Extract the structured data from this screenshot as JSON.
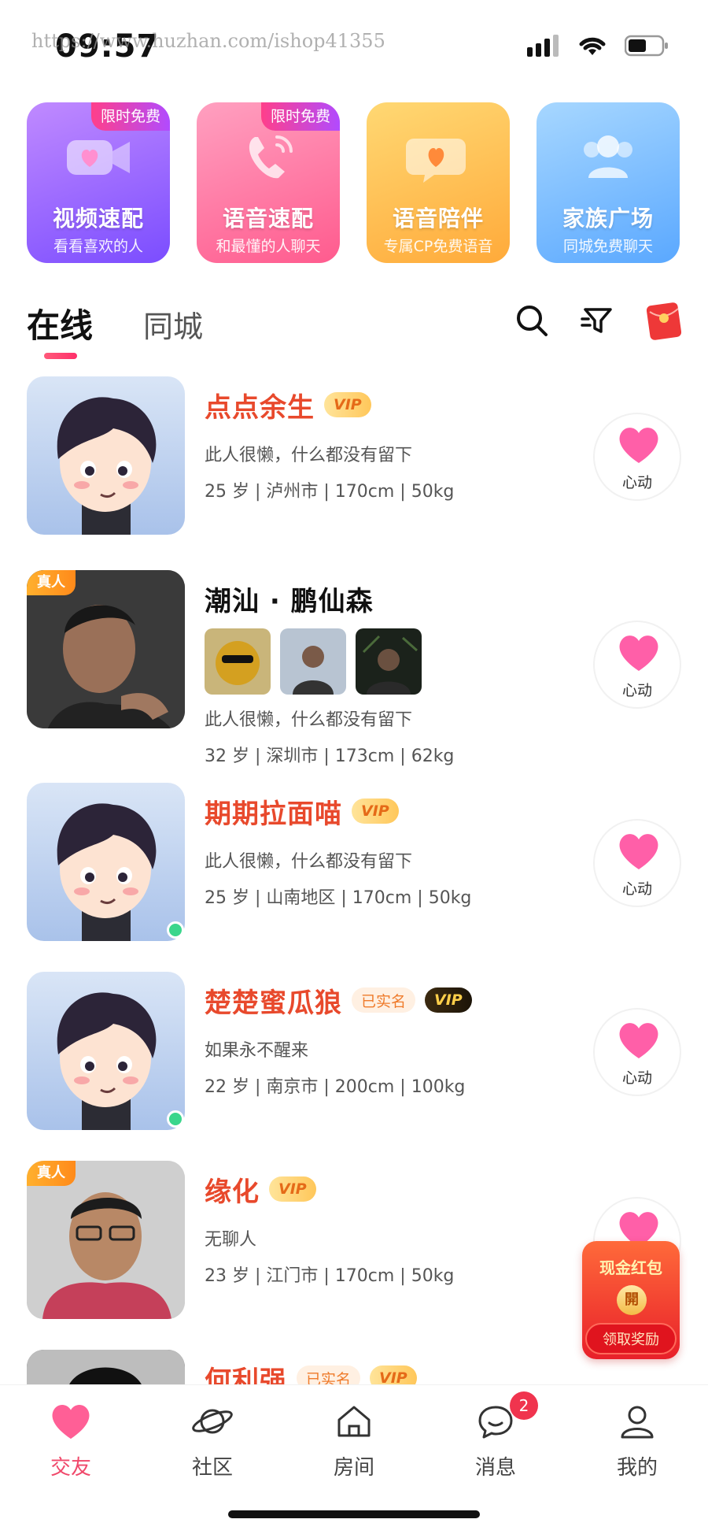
{
  "status_bar": {
    "time": "09:57",
    "watermark": "https://www.huzhan.com/ishop41355"
  },
  "features": [
    {
      "title": "视频速配",
      "subtitle": "看看喜欢的人",
      "badge": "限时免费",
      "gradient_from": "#b57bff",
      "gradient_to": "#7a4dff",
      "icon": "video-camera-icon"
    },
    {
      "title": "语音速配",
      "subtitle": "和最懂的人聊天",
      "badge": "限时免费",
      "gradient_from": "#ff93b6",
      "gradient_to": "#ff5f8f",
      "icon": "phone-icon"
    },
    {
      "title": "语音陪伴",
      "subtitle": "专属CP免费语音",
      "badge": "",
      "gradient_from": "#ffd466",
      "gradient_to": "#ffab3a",
      "icon": "chat-heart-icon"
    },
    {
      "title": "家族广场",
      "subtitle": "同城免费聊天",
      "badge": "",
      "gradient_from": "#9fd3ff",
      "gradient_to": "#5aa8ff",
      "icon": "group-icon"
    }
  ],
  "tabs": {
    "online": "在线",
    "local": "同城"
  },
  "users": [
    {
      "name": "点点余生",
      "vip": "VIP",
      "verified": "",
      "bio": "此人很懒，什么都没有留下",
      "meta": "25 岁 | 泸州市 | 170cm | 50kg",
      "avatar": "cartoon",
      "real_badge": "",
      "online": false,
      "like_label": "心动"
    },
    {
      "name": "潮汕 · 鹏仙森",
      "vip": "",
      "verified": "",
      "bio": "此人很懒，什么都没有留下",
      "meta": "32 岁 | 深圳市 | 173cm | 62kg",
      "avatar": "photo",
      "real_badge": "真人",
      "online": false,
      "like_label": "心动",
      "thumbs": 3
    },
    {
      "name": "期期拉面喵",
      "vip": "VIP",
      "verified": "",
      "bio": "此人很懒，什么都没有留下",
      "meta": "25 岁 | 山南地区 | 170cm | 50kg",
      "avatar": "cartoon",
      "real_badge": "",
      "online": true,
      "like_label": "心动"
    },
    {
      "name": "楚楚蜜瓜狼",
      "vip": "VIP",
      "vip_style": "dark",
      "verified": "已实名",
      "bio": "如果永不醒来",
      "meta": "22 岁 | 南京市 | 200cm | 100kg",
      "avatar": "cartoon",
      "real_badge": "",
      "online": true,
      "like_label": "心动"
    },
    {
      "name": "缘化",
      "vip": "VIP",
      "verified": "",
      "bio": "无聊人",
      "meta": "23 岁 | 江门市 | 170cm | 50kg",
      "avatar": "photo",
      "real_badge": "真人",
      "online": false,
      "like_label": ""
    },
    {
      "name": "何利强",
      "vip": "VIP",
      "verified": "已实名",
      "bio": "",
      "meta": "",
      "avatar": "photo",
      "real_badge": "",
      "online": false,
      "like_label": ""
    }
  ],
  "red_packet": {
    "title": "现金红包",
    "open": "開",
    "button": "领取奖励"
  },
  "tabbar": [
    {
      "label": "交友",
      "icon": "heart-icon",
      "active": true
    },
    {
      "label": "社区",
      "icon": "planet-icon",
      "active": false
    },
    {
      "label": "房间",
      "icon": "home-icon",
      "active": false
    },
    {
      "label": "消息",
      "icon": "message-icon",
      "active": false,
      "badge": "2"
    },
    {
      "label": "我的",
      "icon": "profile-icon",
      "active": false
    }
  ],
  "colors": {
    "accent": "#f0486a",
    "name_red": "#e8492c",
    "vip_gold": "#ffc75a",
    "online_green": "#3ad68c"
  }
}
